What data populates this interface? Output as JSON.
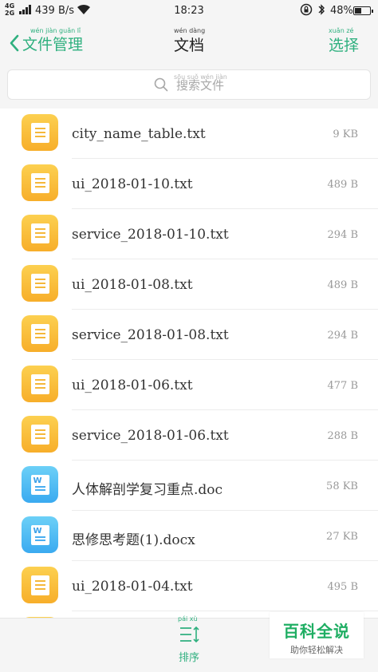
{
  "status_bar": {
    "network": "4G",
    "network2": "2G",
    "speed": "439 B/s",
    "time": "18:23",
    "battery": "48%",
    "battery_level": 0.48
  },
  "header": {
    "back_label": "文件管理",
    "title": "文档",
    "select_label": "选择",
    "back_pinyin": "wén jiàn guǎn lǐ",
    "title_pinyin": "wén dàng",
    "select_pinyin": "xuǎn zé"
  },
  "search": {
    "placeholder": "搜索文件",
    "pinyin": "sōu suǒ wén jiàn"
  },
  "files": [
    {
      "name": "city_name_table.txt",
      "size": "9 KB",
      "type": "txt"
    },
    {
      "name": "ui_2018-01-10.txt",
      "size": "489 B",
      "type": "txt"
    },
    {
      "name": "service_2018-01-10.txt",
      "size": "294 B",
      "type": "txt"
    },
    {
      "name": "ui_2018-01-08.txt",
      "size": "489 B",
      "type": "txt"
    },
    {
      "name": "service_2018-01-08.txt",
      "size": "294 B",
      "type": "txt"
    },
    {
      "name": "ui_2018-01-06.txt",
      "size": "477 B",
      "type": "txt"
    },
    {
      "name": "service_2018-01-06.txt",
      "size": "288 B",
      "type": "txt"
    },
    {
      "name": "人体解剖学复习重点.doc",
      "size": "58 KB",
      "type": "doc"
    },
    {
      "name": "思修思考题(1).docx",
      "size": "27 KB",
      "type": "doc"
    },
    {
      "name": "ui_2018-01-04.txt",
      "size": "495 B",
      "type": "txt"
    },
    {
      "name": "",
      "size": "",
      "type": "txt"
    }
  ],
  "bottom": {
    "sort_label": "排序",
    "sort_pinyin": "pái xù"
  },
  "watermark": {
    "title": "百科全说",
    "subtitle": "助你轻松解决"
  },
  "colors": {
    "accent": "#2fb07f",
    "txt_icon": "#f7ae2a",
    "doc_icon": "#3aaaf0",
    "watermark": "#1fae63"
  }
}
